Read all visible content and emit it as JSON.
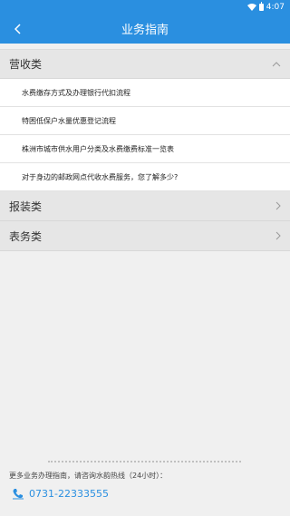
{
  "statusbar": {
    "time": "4:07"
  },
  "appbar": {
    "title": "业务指南"
  },
  "sections": [
    {
      "label": "营收类",
      "expanded": true,
      "items": [
        "水费缴存方式及办理银行代扣流程",
        "特困低保户水量优惠登记流程",
        "株洲市城市供水用户分类及水费缴费标准一览表",
        "对于身边的邮政网点代收水费服务，您了解多少?"
      ]
    },
    {
      "label": "报装类",
      "expanded": false
    },
    {
      "label": "表务类",
      "expanded": false
    }
  ],
  "footer": {
    "hotline_text": "更多业务办理指南，请咨询水韵热线（24小时）：",
    "phone": "0731-22333555"
  },
  "colors": {
    "accent": "#2a8fe0"
  }
}
